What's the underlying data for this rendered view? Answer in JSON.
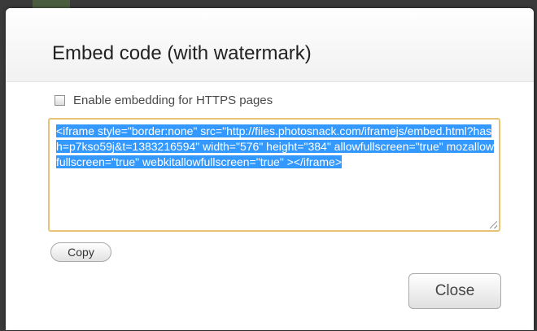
{
  "dialog": {
    "title": "Embed code (with watermark)",
    "https_checkbox": {
      "label": "Enable embedding for HTTPS pages",
      "checked": false
    },
    "embed_code": "<iframe style=\"border:none\" src=\"http://files.photosnack.com/iframejs/embed.html?hash=p7kso59j&t=1383216594\" width=\"576\" height=\"384\" allowfullscreen=\"true\" mozallowfullscreen=\"true\" webkitallowfullscreen=\"true\" ></iframe>",
    "embed_code_selected": true,
    "copy_label": "Copy",
    "close_label": "Close"
  },
  "colors": {
    "selection": "#3399ff",
    "textarea_focus_border": "#e9c277",
    "backdrop": "#3a3a3a"
  }
}
